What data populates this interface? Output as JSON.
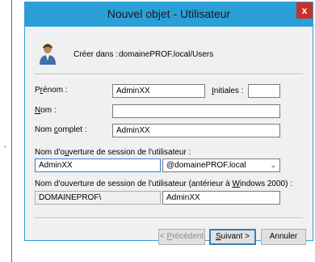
{
  "window": {
    "title": "Nouvel objet - Utilisateur",
    "close_glyph": "x"
  },
  "create_in": {
    "label": "Créer dans :",
    "path": "domainePROF.local/Users",
    "icon": "user-icon"
  },
  "form": {
    "first_name": {
      "label_pre": "P",
      "label_accel": "r",
      "label_post": "énom :",
      "value": "AdminXX"
    },
    "initials": {
      "label_accel": "I",
      "label_post": "nitiales :",
      "value": ""
    },
    "last_name": {
      "label_accel": "N",
      "label_post": "om :",
      "value": ""
    },
    "full_name": {
      "label_pre": "Nom ",
      "label_accel": "c",
      "label_post": "omplet :",
      "value": "AdminXX"
    },
    "logon_name": {
      "label_pre": "Nom d'o",
      "label_accel": "u",
      "label_post": "verture de session de l'utilisateur :",
      "value": "AdminXX",
      "domain_value": "@domainePROF.local"
    },
    "logon_name_pre2000": {
      "label_pre": "Nom d'ouverture de session de l'utilisateur (antérieur à ",
      "label_accel": "W",
      "label_post": "indows 2000) :",
      "domain_prefix": "DOMAINEPROF\\",
      "value": "AdminXX"
    }
  },
  "buttons": {
    "back_pre": "< ",
    "back_accel": "P",
    "back_post": "récédent",
    "next_accel": "S",
    "next_post": "uivant >",
    "cancel": "Annuler"
  },
  "side_mark": "-"
}
